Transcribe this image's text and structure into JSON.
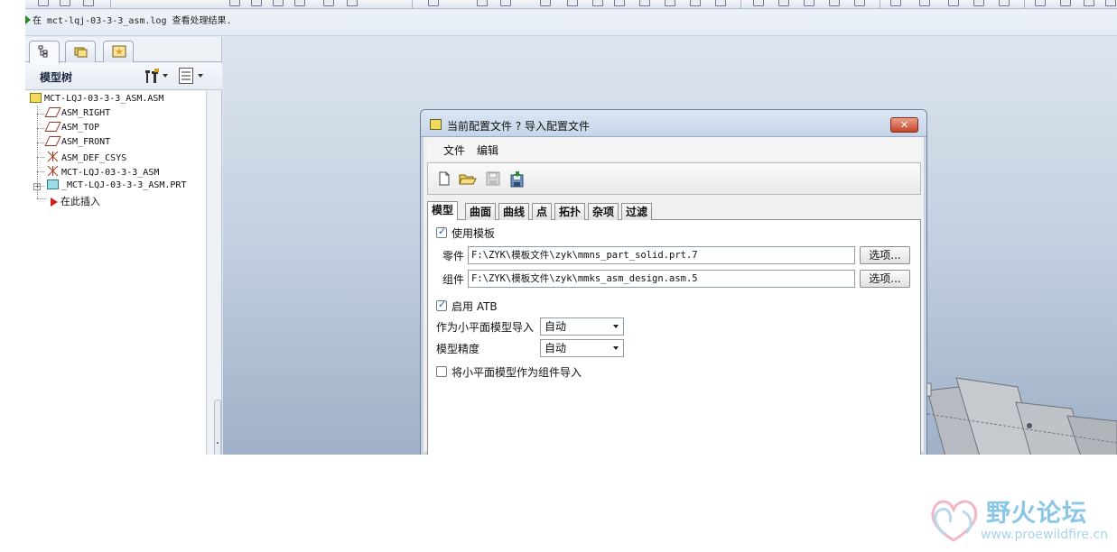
{
  "message_bar": {
    "text": "在 mct-lqj-03-3-3_asm.log 查看处理结果."
  },
  "navigator": {
    "tabs": [
      {
        "icon": "model-tree-tab-icon"
      },
      {
        "icon": "folder-browser-tab-icon"
      },
      {
        "icon": "favorites-tab-icon"
      }
    ],
    "header_title": "模型树",
    "tree": [
      {
        "label": "MCT-LQJ-03-3-3_ASM.ASM",
        "icon": "assembly-icon"
      },
      {
        "label": "ASM_RIGHT",
        "icon": "datum-plane-icon"
      },
      {
        "label": "ASM_TOP",
        "icon": "datum-plane-icon"
      },
      {
        "label": "ASM_FRONT",
        "icon": "datum-plane-icon"
      },
      {
        "label": "ASM_DEF_CSYS",
        "icon": "csys-icon"
      },
      {
        "label": "MCT-LQJ-03-3-3_ASM",
        "icon": "csys-icon"
      },
      {
        "label": "_MCT-LQJ-03-3-3_ASM.PRT",
        "icon": "part-icon"
      },
      {
        "label": "在此插入",
        "icon": "insert-here-icon"
      }
    ]
  },
  "dialog": {
    "title": "当前配置文件 ? 导入配置文件",
    "close_label": "✕",
    "menu": [
      "文件",
      "编辑"
    ],
    "toolbar_icons": [
      "new-file-icon",
      "open-folder-icon",
      "save-icon",
      "save-as-icon"
    ],
    "tabs": [
      "模型",
      "曲面",
      "曲线",
      "点",
      "拓扑",
      "杂项",
      "过滤"
    ],
    "active_tab": "模型",
    "use_template": {
      "label": "使用模板",
      "checked": true
    },
    "part_template": {
      "label": "零件",
      "value": "F:\\ZYK\\模板文件\\zyk\\mmns_part_solid.prt.7",
      "button": "选项..."
    },
    "assembly_template": {
      "label": "组件",
      "value": "F:\\ZYK\\模板文件\\zyk\\mmks_asm_design.asm.5",
      "button": "选项..."
    },
    "enable_atb": {
      "label": "启用 ATB",
      "checked": true
    },
    "facet_import": {
      "label": "作为小平面模型导入",
      "value": "自动"
    },
    "model_accuracy": {
      "label": "模型精度",
      "value": "自动"
    },
    "facet_as_assembly": {
      "label": "将小平面模型作为组件导入",
      "checked": false
    }
  },
  "watermark": {
    "text": "野火论坛",
    "url": "www.proewildfire.cn"
  }
}
